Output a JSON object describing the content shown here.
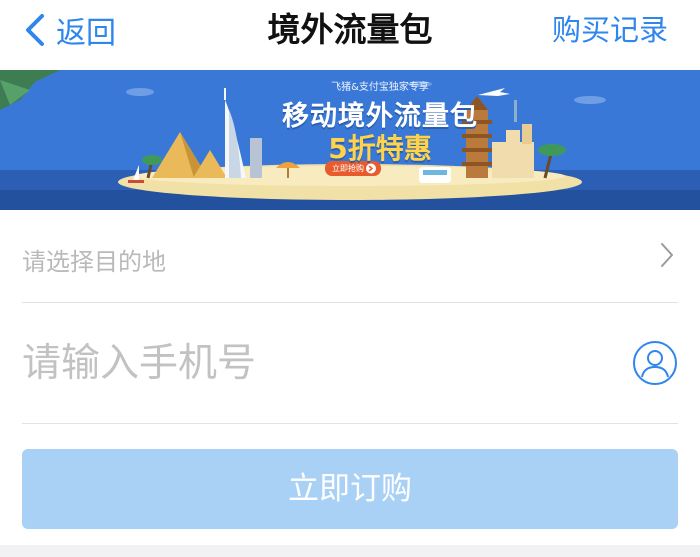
{
  "nav": {
    "back_label": "返回",
    "title": "境外流量包",
    "right_label": "购买记录"
  },
  "banner": {
    "subtitle": "飞猪&支付宝独家专享",
    "title": "移动境外流量包",
    "discount": "5折特惠",
    "button_label": "立即抢购"
  },
  "form": {
    "destination_placeholder": "请选择目的地",
    "phone_placeholder": "请输入手机号"
  },
  "buy_button": {
    "label": "立即订购"
  },
  "icons": [
    "chevron-left-icon",
    "chevron-right-icon",
    "contact-person-icon"
  ],
  "colors": {
    "accent": "#2f86ec",
    "button_disabled": "#a9d0f5",
    "banner_sky": "#3a78d8",
    "placeholder": "#c2c2c2"
  }
}
